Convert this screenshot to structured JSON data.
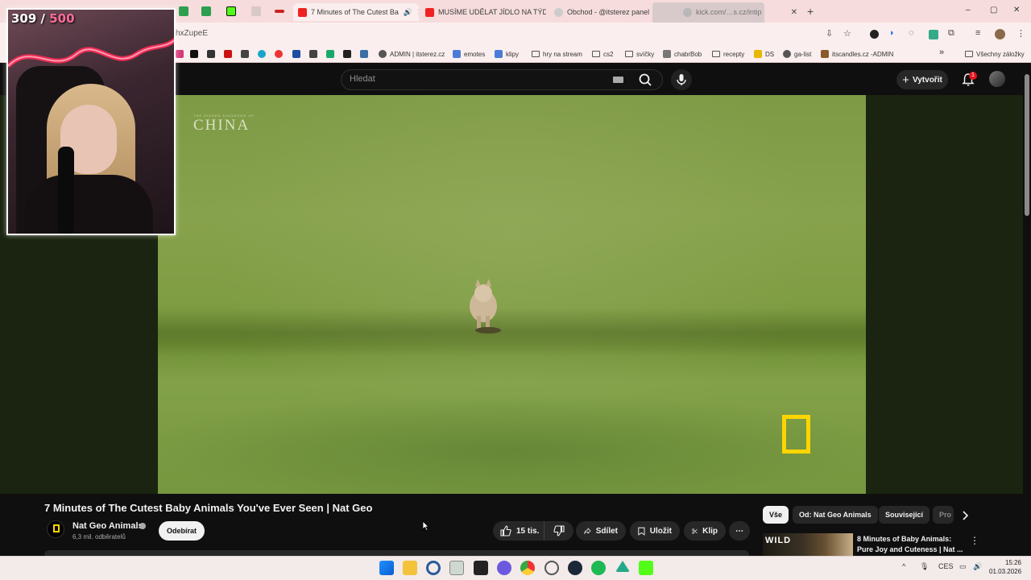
{
  "browser": {
    "tabs": [
      {
        "label": "7 Minutes of The Cutest Ba",
        "active": true
      },
      {
        "label": "MUSÍME UDĚLAT JÍDLO NA TÝD"
      },
      {
        "label": "Obchod - @itsterez panel"
      },
      {
        "label": "kick.com/…s.cz/intip"
      }
    ],
    "new_tab": "+",
    "url": "hxZupeE",
    "window_controls": {
      "minimize": "–",
      "maximize": "▢",
      "close": "✕"
    },
    "bookmarks": [
      {
        "label": "ADMIN | itsterez.cz"
      },
      {
        "label": "emotes"
      },
      {
        "label": "klipy"
      },
      {
        "label": "hry na stream"
      },
      {
        "label": "cs2"
      },
      {
        "label": "svíčky"
      },
      {
        "label": "chabrBob"
      },
      {
        "label": "recepty"
      },
      {
        "label": "DS"
      },
      {
        "label": "ga-list"
      },
      {
        "label": "itscandles.cz -ADMIN"
      }
    ],
    "bookmarks_more": "»",
    "all_bookmarks": "Všechny záložky"
  },
  "overlay": {
    "counter_current": "309",
    "counter_sep": " / ",
    "counter_goal": "500"
  },
  "youtube": {
    "search_placeholder": "Hledat",
    "create_label": "Vytvořit",
    "notifications_count": "1",
    "video": {
      "watermark": "CHINA",
      "watermark_sub": "THE HIDDEN KINGDOMS OF",
      "title": "7 Minutes of The Cutest Baby Animals You've Ever Seen | Nat Geo"
    },
    "channel": {
      "name": "Nat Geo Animals",
      "subscribers": "6,3 mil. odběratelů",
      "subscribe_label": "Odebírat"
    },
    "actions": {
      "likes": "15 tis.",
      "share": "Sdílet",
      "save": "Uložit",
      "clip": "Klip",
      "more": "⋯"
    },
    "chips": [
      "Vše",
      "Od: Nat Geo Animals",
      "Související",
      "Pro"
    ],
    "recommendation": {
      "thumb_label": "WILD",
      "title": "8 Minutes of Baby Animals: Pure Joy and Cuteness | Nat ...",
      "more": "⋮"
    }
  },
  "taskbar": {
    "lang": "CES",
    "time": "15:26",
    "date": "01.03.2026",
    "chevron": "^"
  },
  "colors": {
    "yt_bg": "#0f0f0f",
    "natgeo_yellow": "#ffd500",
    "chrome_tab_bar": "#f6dcdc",
    "counter_goal": "#ff6e9a",
    "notification_red": "#e0141e"
  }
}
